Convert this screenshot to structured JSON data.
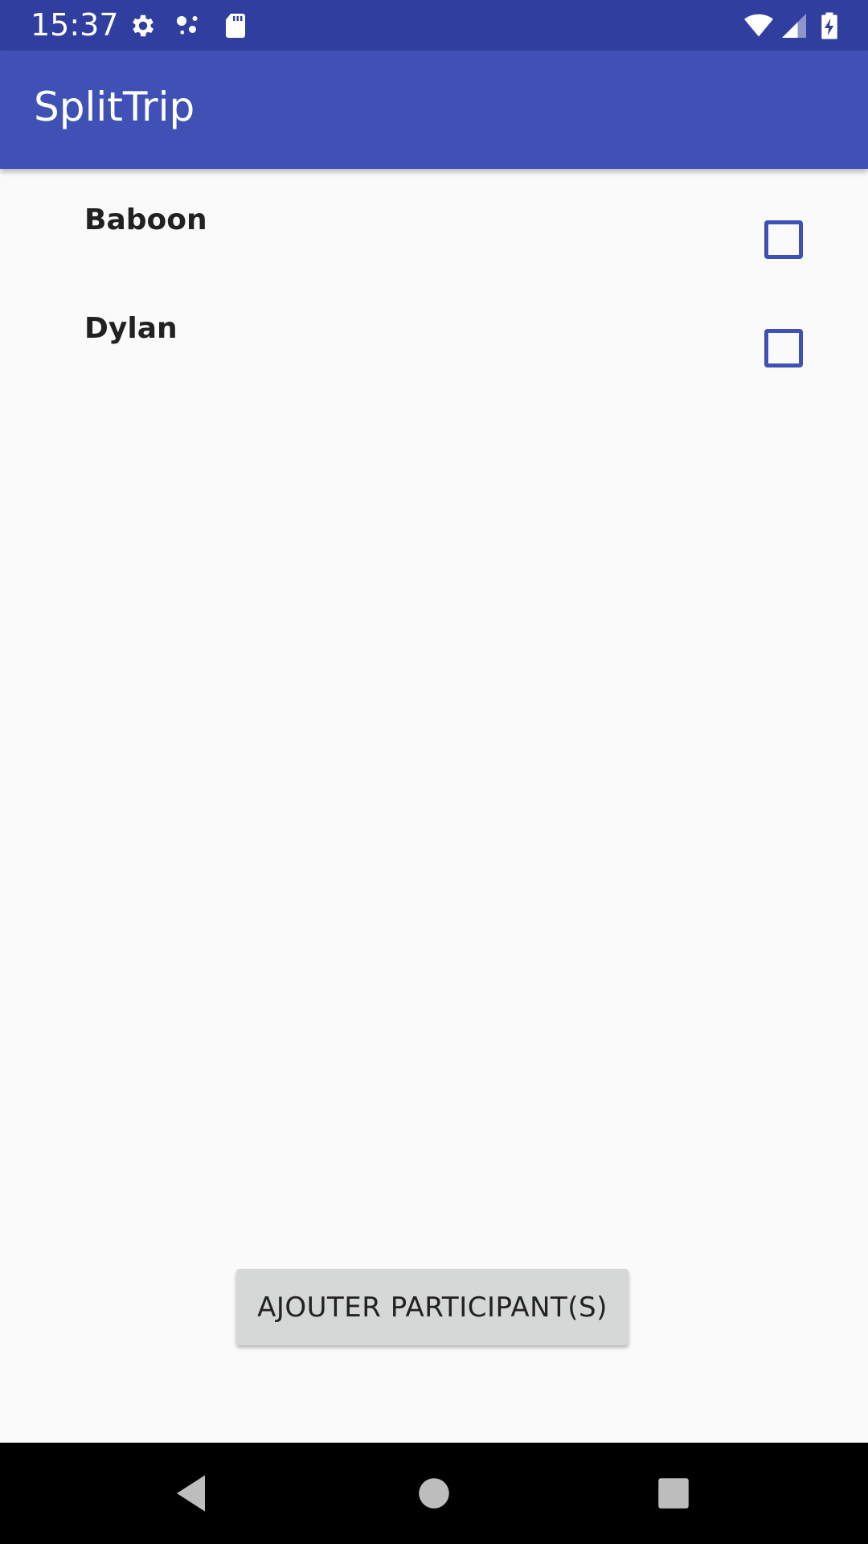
{
  "status_bar": {
    "time": "15:37",
    "icons": [
      "gear-icon",
      "assistant-dots-icon",
      "sd-card-icon",
      "wifi-icon",
      "cell-signal-icon",
      "battery-charging-icon"
    ],
    "color": "#303F9F"
  },
  "app_bar": {
    "title": "SplitTrip",
    "color": "#3F51B5"
  },
  "participants": [
    {
      "name": "Baboon",
      "checked": false
    },
    {
      "name": "Dylan",
      "checked": false
    }
  ],
  "add_button": {
    "label": "AJOUTER PARTICIPANT(S)"
  },
  "nav_bar": {
    "icons": [
      "back-icon",
      "home-icon",
      "recents-icon"
    ]
  },
  "colors": {
    "accent": "#3F51B5",
    "background": "#FAFAFA",
    "button": "#D6D7D7"
  }
}
